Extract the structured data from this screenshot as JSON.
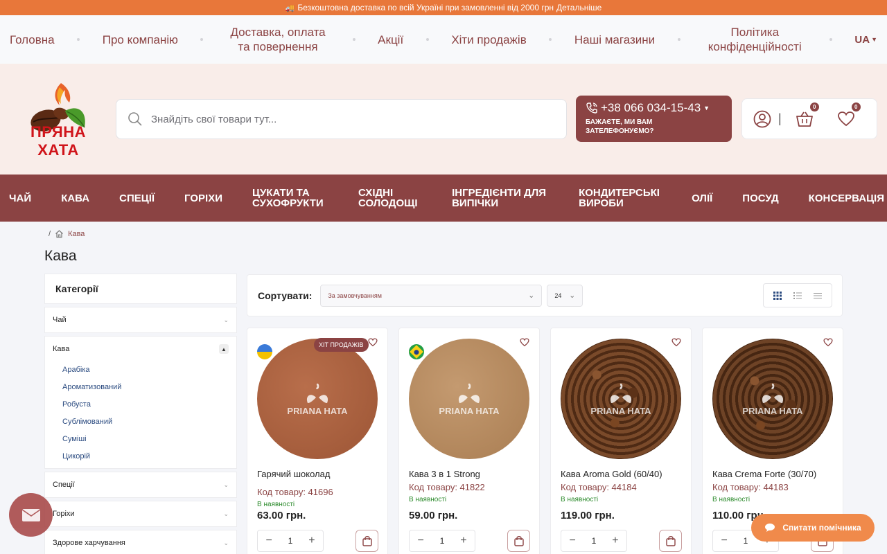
{
  "promo": {
    "icon": "truck-icon",
    "text": "Безкоштовна доставка по всій Україні при замовленні від 2000 грн",
    "link": "Детальніше"
  },
  "topnav": {
    "items": [
      {
        "label": "Головна"
      },
      {
        "label": "Про компанію"
      },
      {
        "label": "Доставка, оплата та повернення"
      },
      {
        "label": "Акції"
      },
      {
        "label": "Хіти продажів"
      },
      {
        "label": "Наші магазини"
      },
      {
        "label": "Політика конфіденційності"
      }
    ],
    "lang": "UA"
  },
  "header": {
    "logo_text": "ПРЯНА ХАТА",
    "search_placeholder": "Знайдіть свої товари тут...",
    "phone": "+38 066 034-15-43",
    "callback": "БАЖАЄТЕ, МИ ВАМ ЗАТЕЛЕФОНУЄМО?",
    "cart_count": "0",
    "wishlist_count": "0"
  },
  "catnav": [
    {
      "label": "ЧАЙ"
    },
    {
      "label": "КАВА"
    },
    {
      "label": "СПЕЦІЇ"
    },
    {
      "label": "ГОРІХИ"
    },
    {
      "label": "ЦУКАТИ ТА СУХОФРУКТИ"
    },
    {
      "label": "СХІДНІ СОЛОДОЩІ"
    },
    {
      "label": "ІНГРЕДІЄНТИ ДЛЯ ВИПІЧКИ"
    },
    {
      "label": "КОНДИТЕРСЬКІ ВИРОБИ"
    },
    {
      "label": "ОЛІЇ"
    },
    {
      "label": "ПОСУД"
    },
    {
      "label": "КОНСЕРВАЦІЯ"
    }
  ],
  "breadcrumb": {
    "sep": "/",
    "current": "Кава"
  },
  "page_title": "Кава",
  "sidebar": {
    "title": "Категорії",
    "items": [
      {
        "label": "Чай"
      },
      {
        "label": "Кава",
        "sub": [
          "Арабіка",
          "Ароматизований",
          "Робуста",
          "Сублімований",
          "Суміші",
          "Цикорій"
        ]
      },
      {
        "label": "Спеції"
      },
      {
        "label": "Горіхи"
      },
      {
        "label": "Здорове харчування"
      }
    ]
  },
  "toolbar": {
    "sort_label": "Сортувати:",
    "sort_value": "За замовчуванням",
    "per_page": "24"
  },
  "products": [
    {
      "name": "Гарячий шоколад",
      "code": "Код товару: 41696",
      "stock": "В наявності",
      "price": "63.00 грн.",
      "qty": "1",
      "badge": "ХІТ ПРОДАЖІВ",
      "watermark": "PRIANA HATA",
      "flag": "ukraine-flag-icon",
      "img_color": "#a8603f"
    },
    {
      "name": "Кава 3 в 1 Strong",
      "code": "Код товару: 41822",
      "stock": "В наявності",
      "price": "59.00 грн.",
      "qty": "1",
      "watermark": "PRIANA HATA",
      "flag": "brazil-flag-icon",
      "img_color": "#b98b60"
    },
    {
      "name": "Кава Aroma Gold (60/40)",
      "code": "Код товару: 44184",
      "stock": "В наявності",
      "price": "119.00 грн.",
      "qty": "1",
      "watermark": "PRIANA HATA",
      "img_color": "#7a4a2a"
    },
    {
      "name": "Кава Crema Forte (30/70)",
      "code": "Код товару: 44183",
      "stock": "В наявності",
      "price": "110.00 грн.",
      "qty": "1",
      "watermark": "PRIANA HATA",
      "img_color": "#6e4326"
    }
  ],
  "assistant_label": "Спитати помічника",
  "colors": {
    "brand": "#8b4343",
    "promo": "#e8773a",
    "assistant": "#f08a4b"
  }
}
